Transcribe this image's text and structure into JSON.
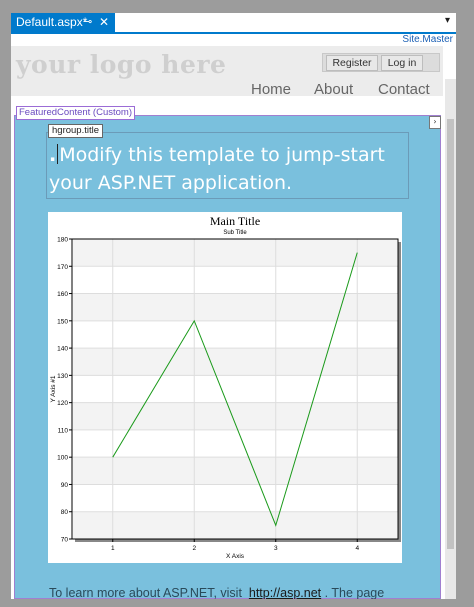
{
  "editor": {
    "tab_title": "Default.aspx*",
    "pin_glyph": "⊸",
    "close_glyph": "✕",
    "dropdown_glyph": "▾",
    "master_label": "Site.Master"
  },
  "page": {
    "logo": "your logo here",
    "login": {
      "register": "Register",
      "login": "Log in"
    },
    "nav": [
      "Home",
      "About",
      "Contact"
    ],
    "featured_tag": "FeaturedContent (Custom)",
    "hgroup_tag": "hgroup.title",
    "expander_glyph": "›",
    "heading_dot": ".",
    "heading_text": "Modify this template to jump-start your ASP.NET application.",
    "footer_prefix": "To learn more about ASP.NET, visit",
    "footer_link": "http://asp.net",
    "footer_suffix": ". The page"
  },
  "chart_data": {
    "type": "line",
    "title": "Main Title",
    "subtitle": "Sub Title",
    "xlabel": "X Axis",
    "ylabel": "Y Axis #1",
    "x": [
      1,
      2,
      3,
      4
    ],
    "values": [
      100,
      150,
      75,
      175
    ],
    "ylim": [
      70,
      180
    ],
    "yticks": [
      70,
      80,
      90,
      100,
      110,
      120,
      130,
      140,
      150,
      160,
      170,
      180
    ],
    "xticks": [
      1,
      2,
      3,
      4
    ],
    "grid": true,
    "line_color": "#1a9a1a"
  },
  "colors": {
    "accent": "#007acc",
    "featured_bg": "#7ac0dd"
  }
}
